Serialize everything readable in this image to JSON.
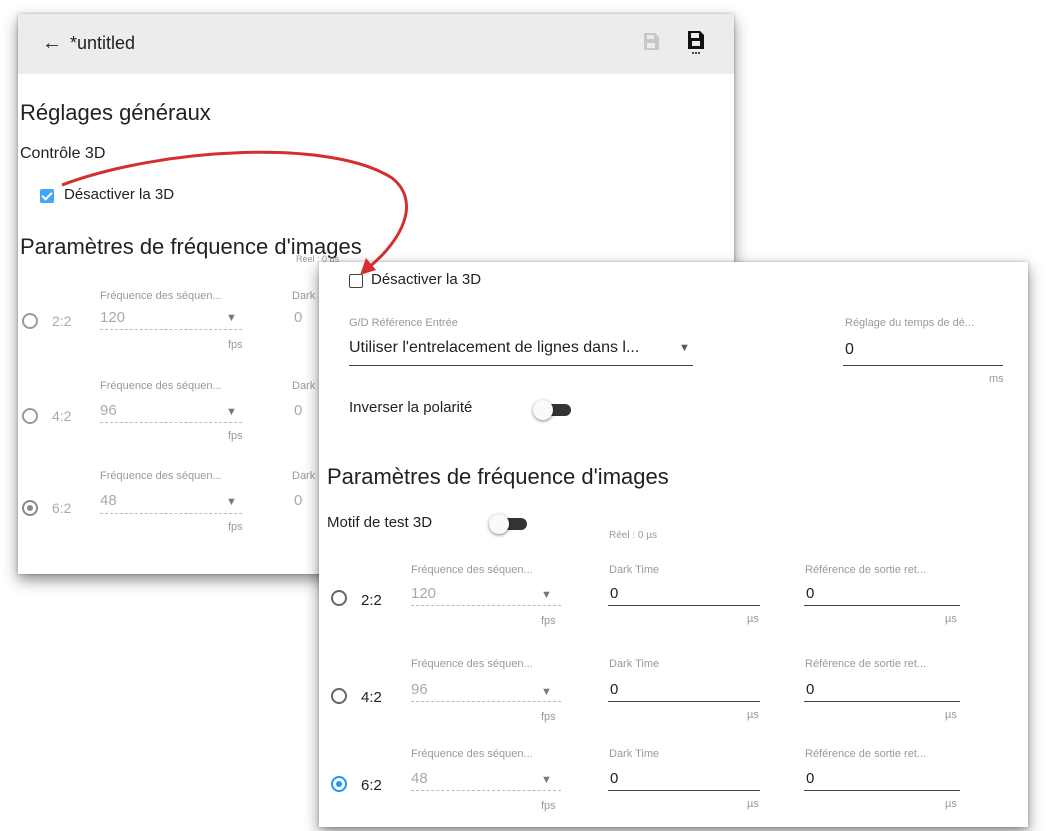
{
  "back": {
    "header": {
      "back_arrow": "←",
      "title": "*untitled"
    },
    "general_title": "Réglages généraux",
    "control_3d": "Contrôle 3D",
    "disable_3d": "Désactiver la 3D",
    "framerate_title": "Paramètres de fréquence d'images",
    "real_label": "Réel : 0 µs",
    "rows": [
      {
        "ratio": "2:2",
        "freq_label": "Fréquence des séquen...",
        "freq_value": "120",
        "freq_unit": "fps",
        "dark_label": "Dark",
        "dark_value": "0",
        "selected": false
      },
      {
        "ratio": "4:2",
        "freq_label": "Fréquence des séquen...",
        "freq_value": "96",
        "freq_unit": "fps",
        "dark_label": "Dark",
        "dark_value": "0",
        "selected": false
      },
      {
        "ratio": "6:2",
        "freq_label": "Fréquence des séquen...",
        "freq_value": "48",
        "freq_unit": "fps",
        "dark_label": "Dark",
        "dark_value": "0",
        "selected": true
      }
    ]
  },
  "front": {
    "disable_3d": "Désactiver la 3D",
    "lr_ref_label": "G/D Référence Entrée",
    "lr_ref_value": "Utiliser l'entrelacement de lignes dans l...",
    "delay_label": "Réglage du temps de dé...",
    "delay_value": "0",
    "delay_unit": "ms",
    "invert_polarity": "Inverser la polarité",
    "framerate_title": "Paramètres de fréquence d'images",
    "test_pattern": "Motif de test 3D",
    "real_label": "Réel : 0 µs",
    "rows": [
      {
        "ratio": "2:2",
        "freq_label": "Fréquence des séquen...",
        "freq_value": "120",
        "freq_unit": "fps",
        "dark_label": "Dark Time",
        "dark_value": "0",
        "dark_unit": "µs",
        "out_label": "Référence de sortie ret...",
        "out_value": "0",
        "out_unit": "µs",
        "selected": false
      },
      {
        "ratio": "4:2",
        "freq_label": "Fréquence des séquen...",
        "freq_value": "96",
        "freq_unit": "fps",
        "dark_label": "Dark Time",
        "dark_value": "0",
        "dark_unit": "µs",
        "out_label": "Référence de sortie ret...",
        "out_value": "0",
        "out_unit": "µs",
        "selected": false
      },
      {
        "ratio": "6:2",
        "freq_label": "Fréquence des séquen...",
        "freq_value": "48",
        "freq_unit": "fps",
        "dark_label": "Dark Time",
        "dark_value": "0",
        "dark_unit": "µs",
        "out_label": "Référence de sortie ret...",
        "out_value": "0",
        "out_unit": "µs",
        "selected": true
      }
    ]
  },
  "icons": {
    "save": "save-icon",
    "save_as": "save-as-icon",
    "arrow": "curved-arrow-annotation"
  },
  "colors": {
    "accent": "#2196f3",
    "arrow": "#d32f2f",
    "header_bg": "#ececec"
  }
}
